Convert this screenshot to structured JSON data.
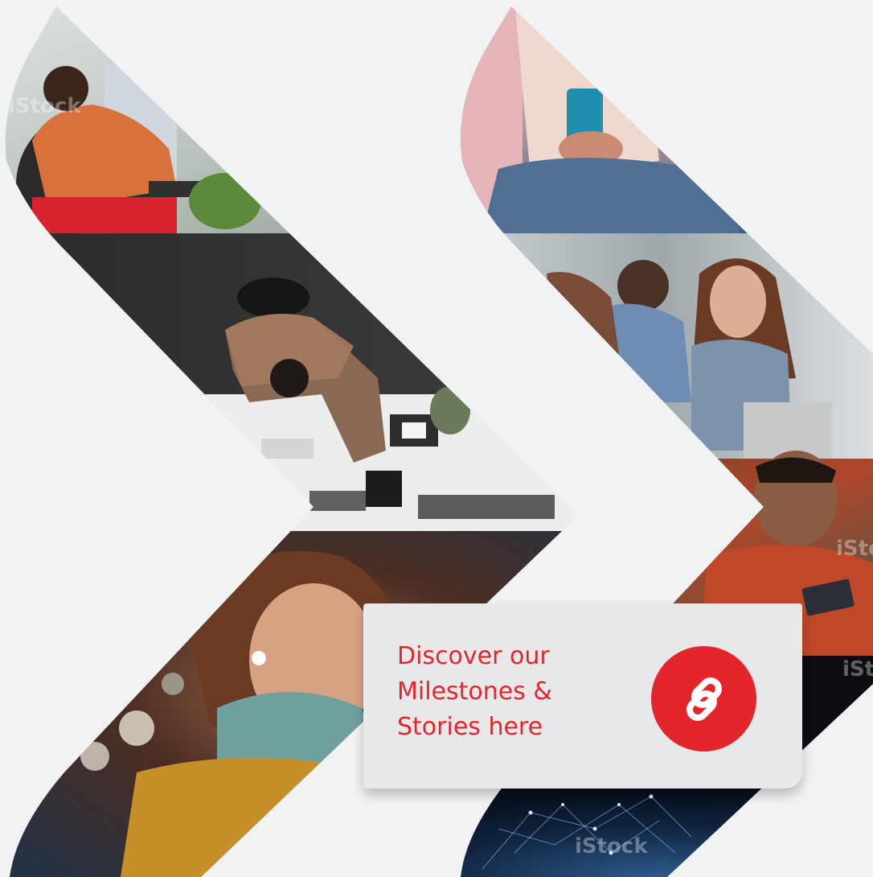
{
  "watermark": "iStock",
  "cta": {
    "lines": [
      "Discover our",
      "Milestones &",
      "Stories here"
    ]
  },
  "icons": {
    "cta_button_icon": "link-icon"
  },
  "colors": {
    "background": "#f1f2f4",
    "card": "#e7e8ea",
    "accent": "#e4262c"
  }
}
